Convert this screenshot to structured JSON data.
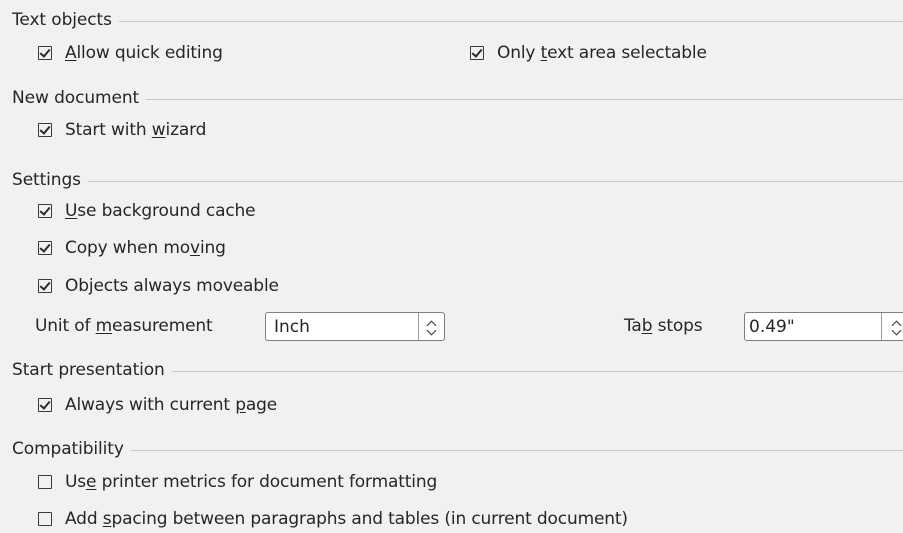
{
  "sections": {
    "text_objects": {
      "title": "Text objects",
      "allow_quick_editing": {
        "label": "Allow quick editing",
        "checked": true
      },
      "only_text_area_selectable": {
        "label": "Only text area selectable",
        "checked": true
      }
    },
    "new_document": {
      "title": "New document",
      "start_with_wizard": {
        "label": "Start with wizard",
        "checked": true
      }
    },
    "settings": {
      "title": "Settings",
      "use_background_cache": {
        "label": "Use background cache",
        "checked": true
      },
      "copy_when_moving": {
        "label": "Copy when moving",
        "checked": true
      },
      "objects_always_moveable": {
        "label": "Objects always moveable",
        "checked": true
      },
      "unit_of_measurement": {
        "label": "Unit of measurement",
        "value": "Inch"
      },
      "tab_stops": {
        "label": "Tab stops",
        "value": "0.49\""
      }
    },
    "start_presentation": {
      "title": "Start presentation",
      "always_with_current_page": {
        "label": "Always with current page",
        "checked": true
      }
    },
    "compatibility": {
      "title": "Compatibility",
      "use_printer_metrics": {
        "label": "Use printer metrics for document formatting",
        "checked": false
      },
      "add_spacing": {
        "label": "Add spacing between paragraphs and tables (in current document)",
        "checked": false
      }
    }
  }
}
